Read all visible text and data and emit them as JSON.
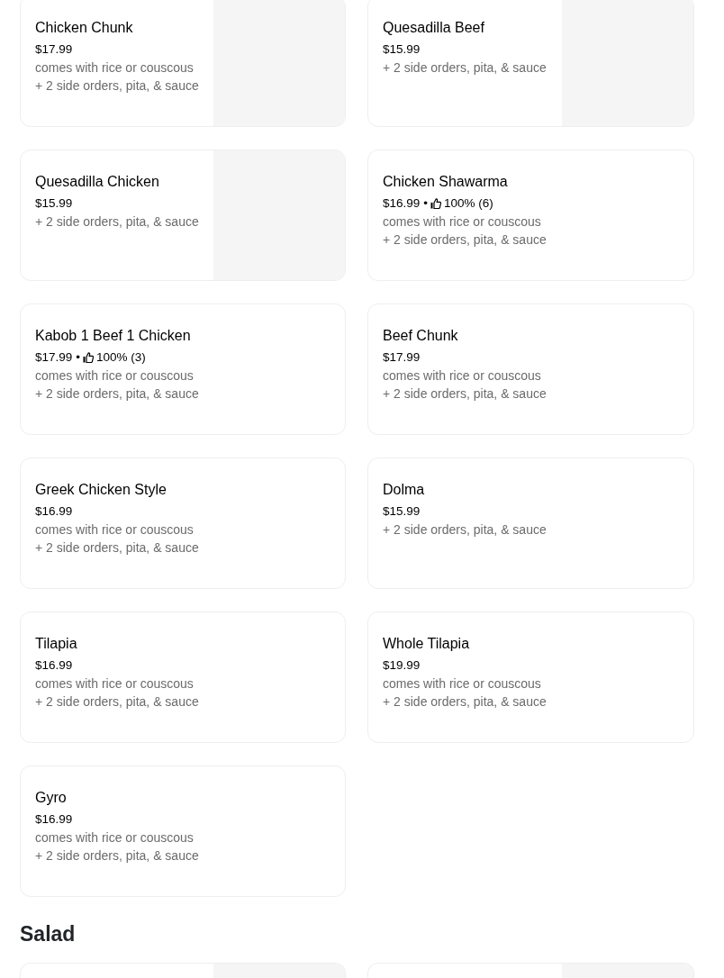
{
  "items": [
    {
      "name": "Chicken Chunk",
      "price": "$17.99",
      "lines": [
        "comes with rice or couscous",
        "+ 2 side orders, pita, & sauce"
      ],
      "image": {
        "kind": "placeholder"
      }
    },
    {
      "name": "Quesadilla Beef",
      "price": "$15.99",
      "lines": [
        "+ 2 side orders, pita, & sauce"
      ],
      "image": {
        "kind": "placeholder"
      }
    },
    {
      "name": "Quesadilla Chicken",
      "price": "$15.99",
      "lines": [
        "+ 2 side orders, pita, & sauce"
      ],
      "image": {
        "kind": "placeholder"
      }
    },
    {
      "name": "Chicken Shawarma",
      "price": "$16.99",
      "rating": {
        "separator": "•",
        "percent": "100%",
        "count": "(6)"
      },
      "lines": [
        "comes with rice or couscous",
        "+ 2 side orders, pita, & sauce"
      ]
    },
    {
      "name": "Kabob 1 Beef 1 Chicken",
      "price": "$17.99",
      "rating": {
        "separator": "•",
        "percent": "100%",
        "count": "(3)"
      },
      "lines": [
        "comes with rice or couscous",
        "+ 2 side orders, pita, & sauce"
      ]
    },
    {
      "name": "Beef Chunk",
      "price": "$17.99",
      "lines": [
        "comes with rice or couscous",
        "+ 2 side orders, pita, & sauce"
      ]
    },
    {
      "name": "Greek Chicken Style",
      "price": "$16.99",
      "lines": [
        "comes with rice or couscous",
        "+ 2 side orders, pita, & sauce"
      ]
    },
    {
      "name": "Dolma",
      "price": "$15.99",
      "lines": [
        "+ 2 side orders, pita, & sauce"
      ]
    },
    {
      "name": "Tilapia",
      "price": "$16.99",
      "lines": [
        "comes with rice or couscous",
        "+ 2 side orders, pita, & sauce"
      ]
    },
    {
      "name": "Whole Tilapia",
      "price": "$19.99",
      "lines": [
        "comes with rice or couscous",
        "+ 2 side orders, pita, & sauce"
      ]
    },
    {
      "name": "Gyro",
      "price": "$16.99",
      "lines": [
        "comes with rice or couscous",
        "+ 2 side orders, pita, & sauce"
      ]
    }
  ],
  "salad": {
    "title": "Salad",
    "items": [
      {
        "image": {
          "kind": "placeholder"
        }
      },
      {
        "image": {
          "kind": "placeholder"
        }
      }
    ]
  }
}
